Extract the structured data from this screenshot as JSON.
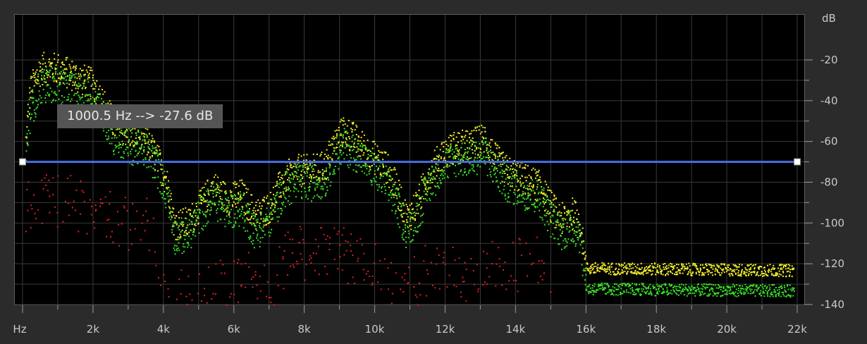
{
  "tooltip": {
    "frequency": "1000.5 Hz",
    "arrow": "-->",
    "level": "-27.6 dB"
  },
  "colors": {
    "background": "#000000",
    "grid": "#3a3a3a",
    "threshold_line": "#4a6fe0",
    "series_peak": "#f2ef2a",
    "series_average": "#38e028",
    "series_low": "#e22222"
  },
  "chart_data": {
    "type": "scatter",
    "title": "",
    "xlabel": "",
    "ylabel": "dB",
    "xlim": [
      0,
      22000
    ],
    "ylim": [
      -140,
      -10
    ],
    "x_ticks": [
      {
        "value": 0,
        "label": "Hz"
      },
      {
        "value": 2000,
        "label": "2k"
      },
      {
        "value": 4000,
        "label": "4k"
      },
      {
        "value": 6000,
        "label": "6k"
      },
      {
        "value": 8000,
        "label": "8k"
      },
      {
        "value": 10000,
        "label": "10k"
      },
      {
        "value": 12000,
        "label": "12k"
      },
      {
        "value": 14000,
        "label": "14k"
      },
      {
        "value": 16000,
        "label": "16k"
      },
      {
        "value": 18000,
        "label": "18k"
      },
      {
        "value": 20000,
        "label": "20k"
      },
      {
        "value": 22000,
        "label": "22k"
      }
    ],
    "y_ticks": [
      {
        "value": -20,
        "label": "-20"
      },
      {
        "value": -40,
        "label": "-40"
      },
      {
        "value": -60,
        "label": "-60"
      },
      {
        "value": -80,
        "label": "-80"
      },
      {
        "value": -100,
        "label": "-100"
      },
      {
        "value": -120,
        "label": "-120"
      },
      {
        "value": -140,
        "label": "-140"
      }
    ],
    "y_unit_label": "dB",
    "threshold": {
      "value": -70,
      "x_start": 0,
      "x_end": 22000
    },
    "grid": true,
    "series": [
      {
        "color": "#f2ef2a",
        "spread": 8,
        "profile": [
          [
            80,
            -60
          ],
          [
            200,
            -35
          ],
          [
            500,
            -24
          ],
          [
            1000,
            -24
          ],
          [
            1500,
            -28
          ],
          [
            2000,
            -32
          ],
          [
            2300,
            -42
          ],
          [
            2600,
            -52
          ],
          [
            3000,
            -55
          ],
          [
            3500,
            -60
          ],
          [
            3800,
            -68
          ],
          [
            4100,
            -80
          ],
          [
            4300,
            -100
          ],
          [
            4700,
            -100
          ],
          [
            5000,
            -92
          ],
          [
            5400,
            -82
          ],
          [
            5800,
            -88
          ],
          [
            6200,
            -86
          ],
          [
            6600,
            -96
          ],
          [
            7000,
            -92
          ],
          [
            7400,
            -78
          ],
          [
            7800,
            -74
          ],
          [
            8200,
            -74
          ],
          [
            8600,
            -72
          ],
          [
            8800,
            -62
          ],
          [
            9100,
            -54
          ],
          [
            9500,
            -60
          ],
          [
            10000,
            -68
          ],
          [
            10300,
            -72
          ],
          [
            10600,
            -82
          ],
          [
            10900,
            -98
          ],
          [
            11200,
            -90
          ],
          [
            11500,
            -76
          ],
          [
            11900,
            -66
          ],
          [
            12300,
            -62
          ],
          [
            12700,
            -62
          ],
          [
            13100,
            -58
          ],
          [
            13400,
            -68
          ],
          [
            13700,
            -74
          ],
          [
            14200,
            -78
          ],
          [
            14700,
            -82
          ],
          [
            15000,
            -92
          ],
          [
            15300,
            -98
          ],
          [
            15600,
            -95
          ],
          [
            15800,
            -98
          ],
          [
            16000,
            -122
          ],
          [
            21900,
            -123
          ]
        ]
      },
      {
        "color": "#38e028",
        "spread": 9,
        "profile": [
          [
            80,
            -66
          ],
          [
            200,
            -45
          ],
          [
            500,
            -32
          ],
          [
            1000,
            -32
          ],
          [
            1500,
            -35
          ],
          [
            2000,
            -38
          ],
          [
            2300,
            -48
          ],
          [
            2600,
            -58
          ],
          [
            3000,
            -62
          ],
          [
            3500,
            -64
          ],
          [
            3800,
            -72
          ],
          [
            4100,
            -86
          ],
          [
            4300,
            -106
          ],
          [
            4700,
            -106
          ],
          [
            5000,
            -96
          ],
          [
            5400,
            -88
          ],
          [
            5800,
            -94
          ],
          [
            6200,
            -92
          ],
          [
            6600,
            -104
          ],
          [
            7000,
            -98
          ],
          [
            7400,
            -84
          ],
          [
            7800,
            -80
          ],
          [
            8200,
            -80
          ],
          [
            8600,
            -78
          ],
          [
            8800,
            -68
          ],
          [
            9100,
            -62
          ],
          [
            9500,
            -66
          ],
          [
            10000,
            -75
          ],
          [
            10300,
            -80
          ],
          [
            10600,
            -90
          ],
          [
            10900,
            -104
          ],
          [
            11200,
            -96
          ],
          [
            11500,
            -82
          ],
          [
            11900,
            -72
          ],
          [
            12300,
            -68
          ],
          [
            12700,
            -68
          ],
          [
            13100,
            -66
          ],
          [
            13400,
            -74
          ],
          [
            13700,
            -80
          ],
          [
            14200,
            -84
          ],
          [
            14700,
            -88
          ],
          [
            15000,
            -98
          ],
          [
            15300,
            -104
          ],
          [
            15600,
            -102
          ],
          [
            15800,
            -104
          ],
          [
            16000,
            -132
          ],
          [
            21900,
            -133
          ]
        ]
      },
      {
        "color": "#e22222",
        "spread": 14,
        "profile": [
          [
            80,
            -95
          ],
          [
            500,
            -88
          ],
          [
            1000,
            -90
          ],
          [
            1500,
            -90
          ],
          [
            2000,
            -92
          ],
          [
            2500,
            -96
          ],
          [
            3000,
            -100
          ],
          [
            3400,
            -98
          ],
          [
            3700,
            -108
          ],
          [
            3800,
            -135
          ],
          [
            4000,
            -138
          ],
          [
            4700,
            -136
          ],
          [
            5200,
            -134
          ],
          [
            5800,
            -130
          ],
          [
            6400,
            -128
          ],
          [
            7000,
            -132
          ],
          [
            7400,
            -122
          ],
          [
            7600,
            -112
          ],
          [
            8000,
            -114
          ],
          [
            8600,
            -114
          ],
          [
            9200,
            -116
          ],
          [
            9800,
            -120
          ],
          [
            10200,
            -126
          ],
          [
            10600,
            -132
          ],
          [
            11000,
            -134
          ],
          [
            11300,
            -122
          ],
          [
            11800,
            -122
          ],
          [
            12400,
            -125
          ],
          [
            13000,
            -122
          ],
          [
            13500,
            -118
          ],
          [
            14000,
            -120
          ],
          [
            14500,
            -118
          ],
          [
            14800,
            -125
          ],
          [
            15000,
            -135
          ]
        ]
      }
    ]
  }
}
